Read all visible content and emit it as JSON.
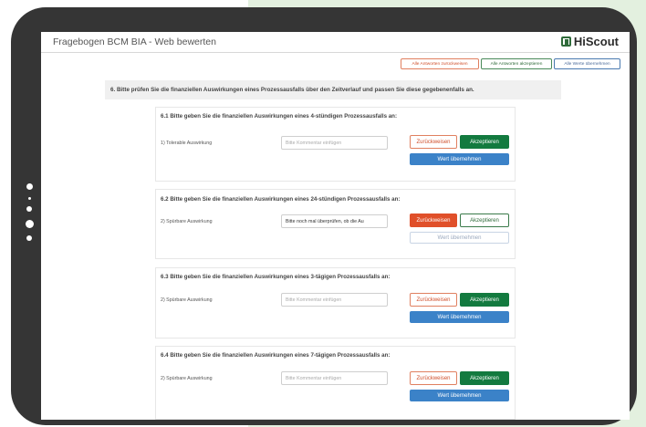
{
  "app": {
    "title": "Fragebogen BCM BIA - Web bewerten",
    "brand": "HiScout"
  },
  "toolbar": {
    "reject_all": "Alle Antworten zurückweisen",
    "accept_all": "Alle Antworten akzeptieren",
    "apply_all": "Alle Werte übernehmen"
  },
  "section": {
    "title": "6. Bitte prüfen Sie die finanziellen Auswirkungen eines Prozessausfalls über den Zeitverlauf und passen Sie diese gegebenenfalls an."
  },
  "questions": [
    {
      "title": "6.1 Bitte geben Sie die finanziellen Auswirkungen eines 4-stündigen Prozessausfalls an:",
      "impact": "1) Tolerable Auswirkung",
      "comment_value": "",
      "comment_placeholder": "Bitte Kommentar einfügen",
      "reject_label": "Zurückweisen",
      "accept_label": "Akzeptieren",
      "apply_label": "Wert übernehmen"
    },
    {
      "title": "6.2 Bitte geben Sie die finanziellen Auswirkungen eines 24-stündigen Prozessausfalls an:",
      "impact": "2) Spürbare Auswirkung",
      "comment_value": "Bitte noch mal überprüfen, ob die Au",
      "comment_placeholder": "",
      "reject_label": "Zurückweisen",
      "accept_label": "Akzeptieren",
      "apply_label": "Wert übernehmen"
    },
    {
      "title": "6.3 Bitte geben Sie die finanziellen Auswirkungen eines 3-tägigen Prozessausfalls an:",
      "impact": "2) Spürbare Auswirkung",
      "comment_value": "",
      "comment_placeholder": "Bitte Kommentar einfügen",
      "reject_label": "Zurückweisen",
      "accept_label": "Akzeptieren",
      "apply_label": "Wert übernehmen"
    },
    {
      "title": "6.4 Bitte geben Sie die finanziellen Auswirkungen eines 7-tägigen Prozessausfalls an:",
      "impact": "2) Spürbare Auswirkung",
      "comment_value": "",
      "comment_placeholder": "Bitte Kommentar einfügen",
      "reject_label": "Zurückweisen",
      "accept_label": "Akzeptieren",
      "apply_label": "Wert übernehmen"
    }
  ],
  "colors": {
    "reject": "#e0502a",
    "accept": "#137a3f",
    "apply": "#3b82c8",
    "frame": "#353535",
    "background_accent": "#e3f0df"
  }
}
